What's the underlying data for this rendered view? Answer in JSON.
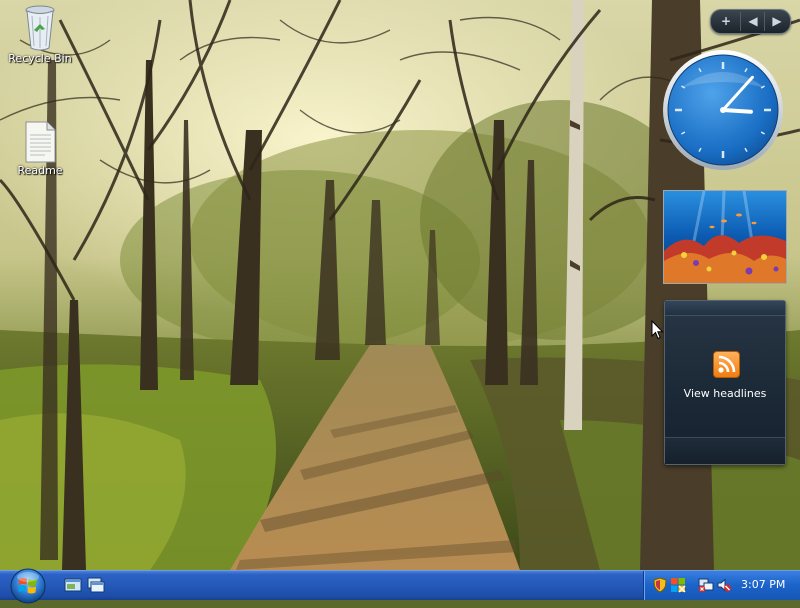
{
  "desktop": {
    "icons": [
      {
        "label": "Recycle Bin",
        "icon": "recycle-bin-icon"
      },
      {
        "label": "Readme",
        "icon": "text-document-icon"
      }
    ]
  },
  "sidebar": {
    "controls": {
      "add": "+",
      "prev": "◀",
      "next": "▶"
    },
    "clock": {
      "hour": 3,
      "minute": 7
    },
    "feed": {
      "label": "View headlines",
      "icon": "rss-feed-icon"
    }
  },
  "taskbar": {
    "start_icon": "windows-logo-icon",
    "quick_launch": [
      "show-desktop-icon",
      "switch-windows-icon"
    ],
    "tray_icons": [
      "shield-icon",
      "security-center-icon",
      "network-icon",
      "volume-muted-icon"
    ],
    "clock": "3:07 PM"
  },
  "colors": {
    "taskbar": "#2558b9",
    "tray": "#1c63c9",
    "clock_face": "#1b73c8",
    "feed_gadget": "#1b2836"
  }
}
